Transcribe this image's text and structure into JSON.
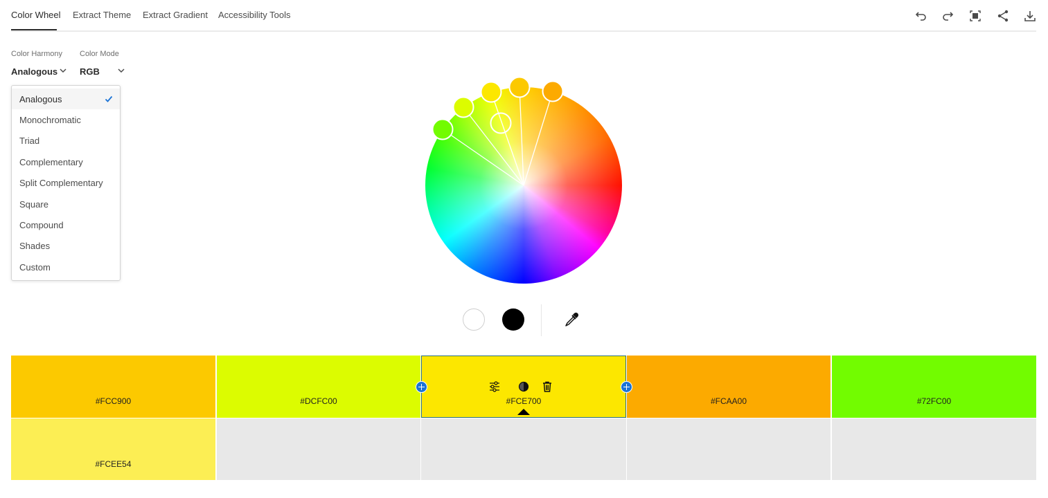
{
  "tabs": [
    {
      "label": "Color Wheel",
      "active": true
    },
    {
      "label": "Extract Theme",
      "active": false
    },
    {
      "label": "Extract Gradient",
      "active": false
    },
    {
      "label": "Accessibility Tools",
      "active": false
    }
  ],
  "toolbar": {
    "undo": "undo-icon",
    "redo": "redo-icon",
    "fullscreen": "fullscreen-icon",
    "share": "share-icon",
    "download": "download-icon"
  },
  "controls": {
    "harmony_label": "Color Harmony",
    "harmony_value": "Analogous",
    "mode_label": "Color Mode",
    "mode_value": "RGB"
  },
  "harmony_menu": {
    "items": [
      "Analogous",
      "Monochromatic",
      "Triad",
      "Complementary",
      "Split Complementary",
      "Square",
      "Compound",
      "Shades",
      "Custom"
    ],
    "selected": "Analogous"
  },
  "wheel": {
    "handles": [
      {
        "color": "#72FC00"
      },
      {
        "color": "#DCFC00"
      },
      {
        "color": "#FCE700",
        "base": true
      },
      {
        "color": "#FCC900"
      },
      {
        "color": "#FCAA00"
      },
      {
        "color": "#FCEE54",
        "outline_only": true
      }
    ]
  },
  "quick_colors": {
    "white": "#FFFFFF",
    "black": "#000000",
    "eyedropper": "eyedropper-icon"
  },
  "swatches": [
    {
      "hex": "#FCC900",
      "color": "#FCC900"
    },
    {
      "hex": "#DCFC00",
      "color": "#DCFC00"
    },
    {
      "hex": "#FCE700",
      "color": "#FCE700",
      "active": true
    },
    {
      "hex": "#FCAA00",
      "color": "#FCAA00"
    },
    {
      "hex": "#72FC00",
      "color": "#72FC00"
    }
  ],
  "shades": [
    {
      "hex": "#FCEE54",
      "color": "#FCEE54"
    },
    {
      "hex": "",
      "color": "#E8E8E8"
    },
    {
      "hex": "",
      "color": "#E8E8E8"
    },
    {
      "hex": "",
      "color": "#E8E8E8"
    },
    {
      "hex": "",
      "color": "#E8E8E8"
    }
  ],
  "active_swatch_tools": [
    "adjust-sliders-icon",
    "contrast-icon",
    "delete-icon"
  ],
  "accent_color": "#1A73D6"
}
